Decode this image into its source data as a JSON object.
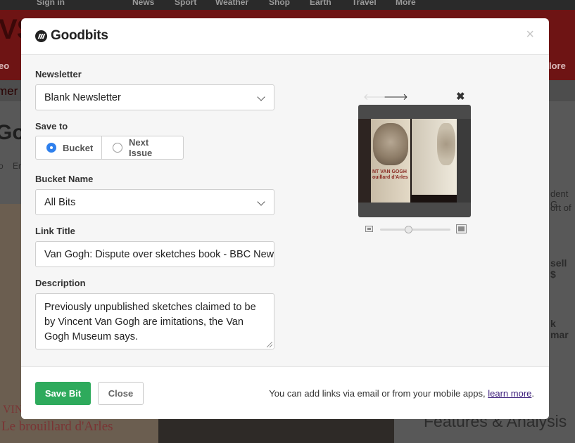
{
  "background": {
    "nav": [
      "Sign in",
      "News",
      "Sport",
      "Weather",
      "Shop",
      "Earth",
      "Travel",
      "More"
    ],
    "logo_fragment": "VS",
    "subnav_left": "eo",
    "subnav_right": "lore",
    "section_fragment": "mer",
    "headline_fragment": "Go",
    "breadcrumb_left": "o",
    "breadcrumb_right": "Er",
    "side_text_1": "dent G",
    "side_text_2": "ort of",
    "side_text_3": "sell $",
    "side_text_4": "k mar",
    "photo_caption": "Le brouillard d'Arles",
    "photo_caption_2": "VIN",
    "features_heading": "Features & Analysis"
  },
  "modal": {
    "brand": "Goodbits",
    "close_icon": "×",
    "newsletter": {
      "label": "Newsletter",
      "value": "Blank Newsletter"
    },
    "save_to": {
      "label": "Save to",
      "options": [
        {
          "label": "Bucket",
          "selected": true
        },
        {
          "label": "Next Issue",
          "selected": false
        }
      ]
    },
    "bucket_name": {
      "label": "Bucket Name",
      "value": "All Bits"
    },
    "link_title": {
      "label": "Link Title",
      "value": "Van Gogh: Dispute over sketches book - BBC News"
    },
    "description": {
      "label": "Description",
      "value": "Previously unpublished sketches claimed to be by Vincent Van Gogh are imitations, the Van Gogh Museum says."
    },
    "preview": {
      "prev_arrow": "🡐",
      "next_arrow": "🡒",
      "remove_icon": "✖",
      "book_title_line1": "NT VAN GOGH",
      "book_title_line2": "ouillard d'Arles",
      "zoom_level": 0.4
    },
    "footer": {
      "save_label": "Save Bit",
      "close_label": "Close",
      "note_text": "You can add links via email or from your mobile apps, ",
      "note_link": "learn more",
      "note_end": "."
    }
  }
}
